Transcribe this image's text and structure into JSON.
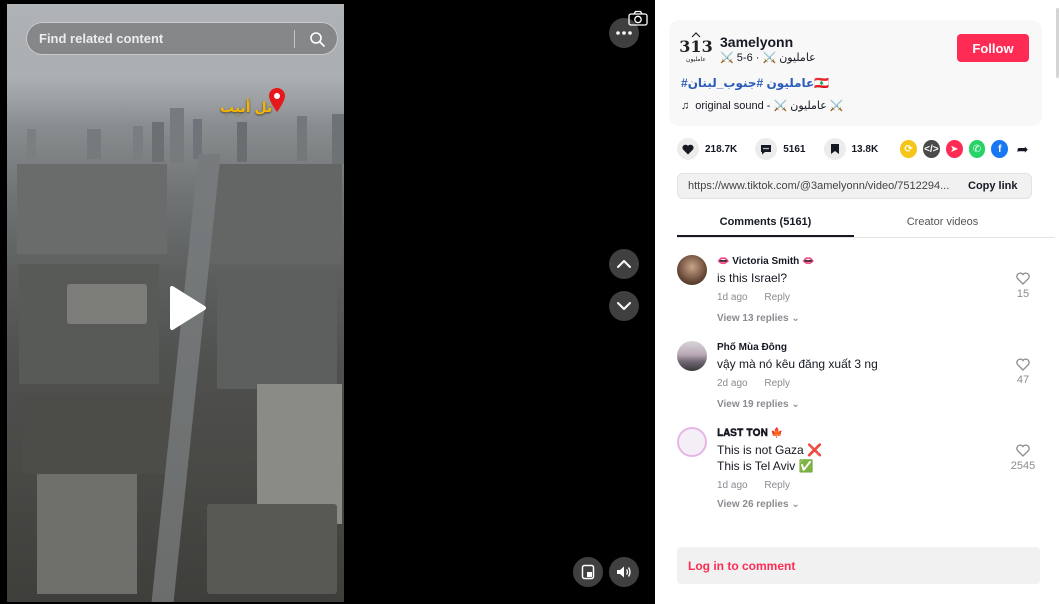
{
  "video": {
    "search_placeholder": "Find related content",
    "location_label": "تل أبيب",
    "play_label": "Play",
    "icons": {
      "search": "search-icon",
      "more": "ellipsis-icon",
      "camera": "camera-icon",
      "up": "chevron-up-icon",
      "down": "chevron-down-icon",
      "mini": "mini-player-icon",
      "volume": "volume-icon",
      "pin": "location-pin-icon"
    }
  },
  "author": {
    "avatar_text": "313",
    "avatar_subtext": "عامليون",
    "name": "3amelyonn",
    "meta": "⚔️ عامليون ⚔️ · 6-5",
    "follow_label": "Follow",
    "hashtags": "#عامليون #جنوب_لبنان🇱🇧",
    "sound": "original sound - ⚔️ عامليون ⚔️"
  },
  "actions": {
    "likes": "218.7K",
    "comments": "5161",
    "saves": "13.8K",
    "share_targets": [
      "repost",
      "embed",
      "send",
      "whatsapp",
      "facebook",
      "share"
    ]
  },
  "link": {
    "url": "https://www.tiktok.com/@3amelyonn/video/7512294...",
    "copy_label": "Copy link"
  },
  "tabs": [
    {
      "label": "Comments (5161)",
      "active": true
    },
    {
      "label": "Creator videos",
      "active": false
    }
  ],
  "comments": [
    {
      "user": "👄 Victoria Smith 👄",
      "text": [
        "is this Israel?"
      ],
      "time": "1d ago",
      "reply_label": "Reply",
      "view_replies": "View 13 replies",
      "likes": "15"
    },
    {
      "user": "Phố Mùa Đông",
      "text": [
        "vậy mà nó kêu đăng xuất 3 ng"
      ],
      "time": "2d ago",
      "reply_label": "Reply",
      "view_replies": "View 19 replies",
      "likes": "47"
    },
    {
      "user": "𝐋𝐀𝐒𝐓 𝐓𝐎𝐍 🍁",
      "text": [
        "This is not Gaza ❌",
        "This is Tel Aviv ✅"
      ],
      "time": "1d ago",
      "reply_label": "Reply",
      "view_replies": "View 26 replies",
      "likes": "2545"
    }
  ],
  "login_label": "Log in to comment",
  "colors": {
    "brand": "#fe2c55",
    "hashtag": "#2b5db9",
    "muted": "#8a8b91"
  }
}
